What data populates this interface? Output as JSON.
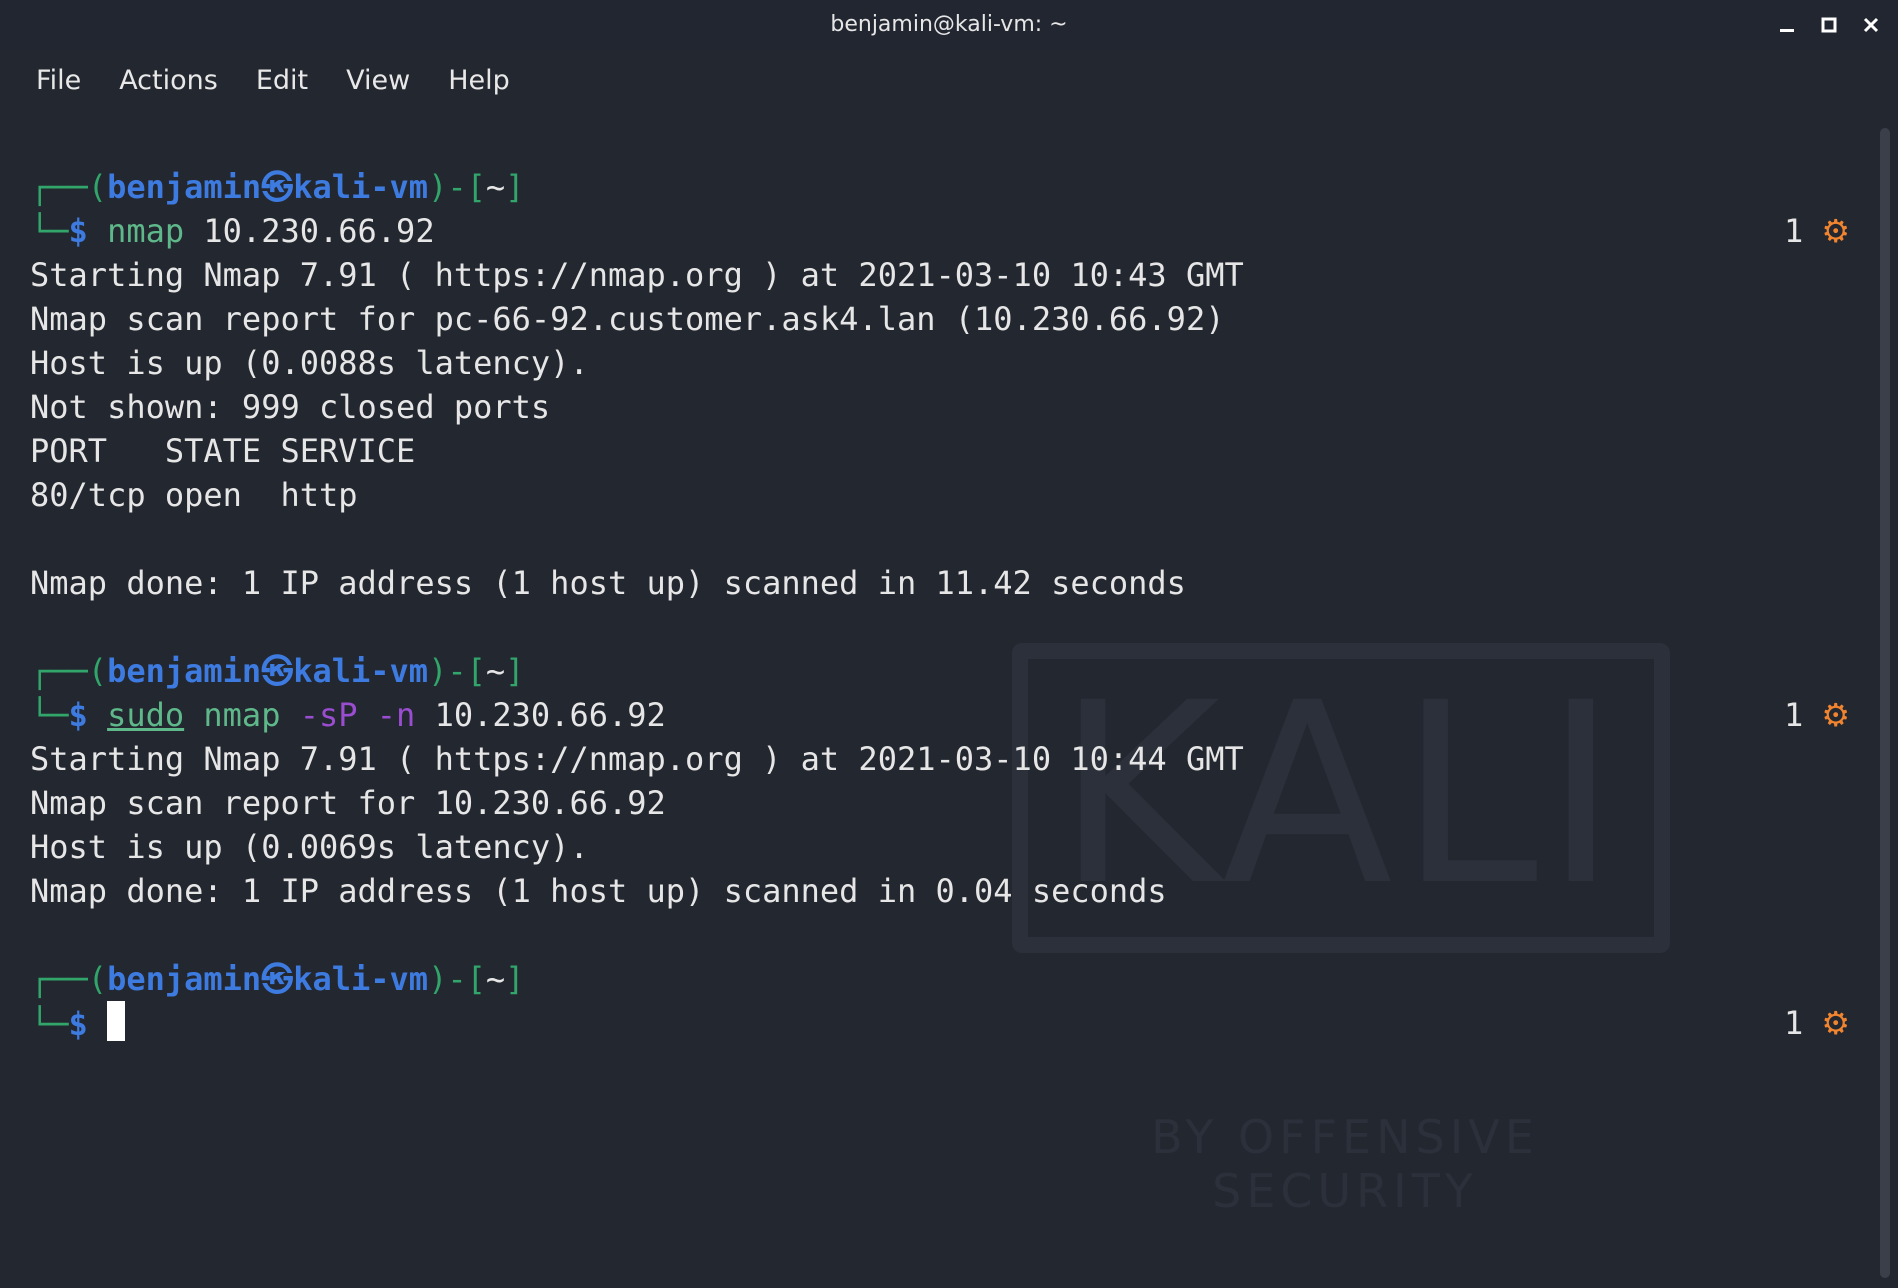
{
  "window": {
    "title": "benjamin@kali-vm: ~",
    "controls": {
      "minimize": "minimize-icon",
      "maximize": "maximize-icon",
      "close": "close-icon"
    }
  },
  "menu": {
    "items": [
      "File",
      "Actions",
      "Edit",
      "View",
      "Help"
    ]
  },
  "wallpaper": {
    "logo_word": "KALI",
    "logo_sub": "BY OFFENSIVE SECURITY"
  },
  "prompt": {
    "open": "(",
    "user": "benjamin",
    "at_symbol": "㉿",
    "host": "kali-vm",
    "close": ")-[",
    "dir": "~",
    "end": "]",
    "dollar": "$"
  },
  "blocks": [
    {
      "command": {
        "parts": [
          {
            "text": "nmap",
            "kind": "cmd"
          },
          {
            "text": " 10.230.66.92",
            "kind": "arg"
          }
        ]
      },
      "status": {
        "count": "1",
        "icon": "gear-icon"
      },
      "output": [
        "Starting Nmap 7.91 ( https://nmap.org ) at 2021-03-10 10:43 GMT",
        "Nmap scan report for pc-66-92.customer.ask4.lan (10.230.66.92)",
        "Host is up (0.0088s latency).",
        "Not shown: 999 closed ports",
        "PORT   STATE SERVICE",
        "80/tcp open  http",
        "",
        "Nmap done: 1 IP address (1 host up) scanned in 11.42 seconds",
        ""
      ]
    },
    {
      "command": {
        "parts": [
          {
            "text": "sudo",
            "kind": "sudo"
          },
          {
            "text": " nmap",
            "kind": "cmd"
          },
          {
            "text": " -sP",
            "kind": "opt"
          },
          {
            "text": " -n",
            "kind": "opt"
          },
          {
            "text": " 10.230.66.92",
            "kind": "arg"
          }
        ]
      },
      "status": {
        "count": "1",
        "icon": "gear-icon"
      },
      "output": [
        "Starting Nmap 7.91 ( https://nmap.org ) at 2021-03-10 10:44 GMT",
        "Nmap scan report for 10.230.66.92",
        "Host is up (0.0069s latency).",
        "Nmap done: 1 IP address (1 host up) scanned in 0.04 seconds",
        ""
      ]
    },
    {
      "command": {
        "parts": []
      },
      "status": {
        "count": "1",
        "icon": "gear-icon"
      },
      "output": [],
      "active": true
    }
  ],
  "colors": {
    "background": "#232730",
    "prompt_user": "#3d7be0",
    "frame": "#32a56a",
    "command": "#5fb88a",
    "option": "#9a4dd0",
    "gear": "#f0842f"
  }
}
